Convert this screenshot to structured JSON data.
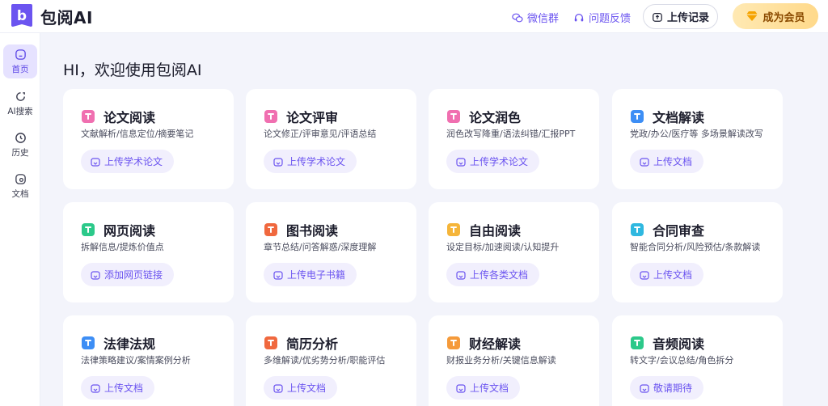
{
  "header": {
    "logo_letter": "b",
    "app_name": "包阅AI",
    "wechat_group": "微信群",
    "feedback": "问题反馈",
    "upload_record": "上传记录",
    "become_member": "成为会员"
  },
  "sidebar": {
    "items": [
      {
        "label": "首页",
        "icon": "home-icon"
      },
      {
        "label": "AI搜索",
        "icon": "ai-search-icon"
      },
      {
        "label": "历史",
        "icon": "clock-icon"
      },
      {
        "label": "文档",
        "icon": "document-icon"
      }
    ]
  },
  "main": {
    "greeting": "HI，欢迎使用包阅AI",
    "cards": [
      {
        "title": "论文阅读",
        "desc": "文献解析/信息定位/摘要笔记",
        "button": "上传学术论文",
        "icon": "paper-read-icon",
        "color": "#f06fb0"
      },
      {
        "title": "论文评审",
        "desc": "论文修正/评审意见/评语总结",
        "button": "上传学术论文",
        "icon": "paper-review-icon",
        "color": "#f06fb0"
      },
      {
        "title": "论文润色",
        "desc": "润色改写降重/语法纠错/汇报PPT",
        "button": "上传学术论文",
        "icon": "paper-polish-icon",
        "color": "#f06fb0"
      },
      {
        "title": "文档解读",
        "desc": "党政/办公/医疗等 多场景解读改写",
        "button": "上传文档",
        "icon": "doc-interpret-icon",
        "color": "#3d8ef5"
      },
      {
        "title": "网页阅读",
        "desc": "拆解信息/提炼价值点",
        "button": "添加网页链接",
        "icon": "web-read-icon",
        "color": "#2cc98a"
      },
      {
        "title": "图书阅读",
        "desc": "章节总结/问答解惑/深度理解",
        "button": "上传电子书籍",
        "icon": "book-read-icon",
        "color": "#f0683e"
      },
      {
        "title": "自由阅读",
        "desc": "设定目标/加速阅读/认知提升",
        "button": "上传各类文档",
        "icon": "free-read-icon",
        "color": "#f5b53a"
      },
      {
        "title": "合同审查",
        "desc": "智能合同分析/风险预估/条款解读",
        "button": "上传文档",
        "icon": "contract-icon",
        "color": "#2fb8e0"
      },
      {
        "title": "法律法规",
        "desc": "法律策略建议/案情案例分析",
        "button": "上传文档",
        "icon": "law-icon",
        "color": "#3d8ef5"
      },
      {
        "title": "简历分析",
        "desc": "多维解读/优劣势分析/职能评估",
        "button": "上传文档",
        "icon": "resume-icon",
        "color": "#f0683e"
      },
      {
        "title": "财经解读",
        "desc": "财报业务分析/关键信息解读",
        "button": "上传文档",
        "icon": "finance-icon",
        "color": "#f59a3a"
      },
      {
        "title": "音频阅读",
        "desc": "转文字/会议总结/角色拆分",
        "button": "敬请期待",
        "icon": "audio-icon",
        "color": "#2cc98a"
      }
    ]
  },
  "colors": {
    "accent": "#6b54f0",
    "active_bg": "#e6e2ff",
    "member_gold": "#ffd98a",
    "page_bg": "#f3f4fb"
  }
}
